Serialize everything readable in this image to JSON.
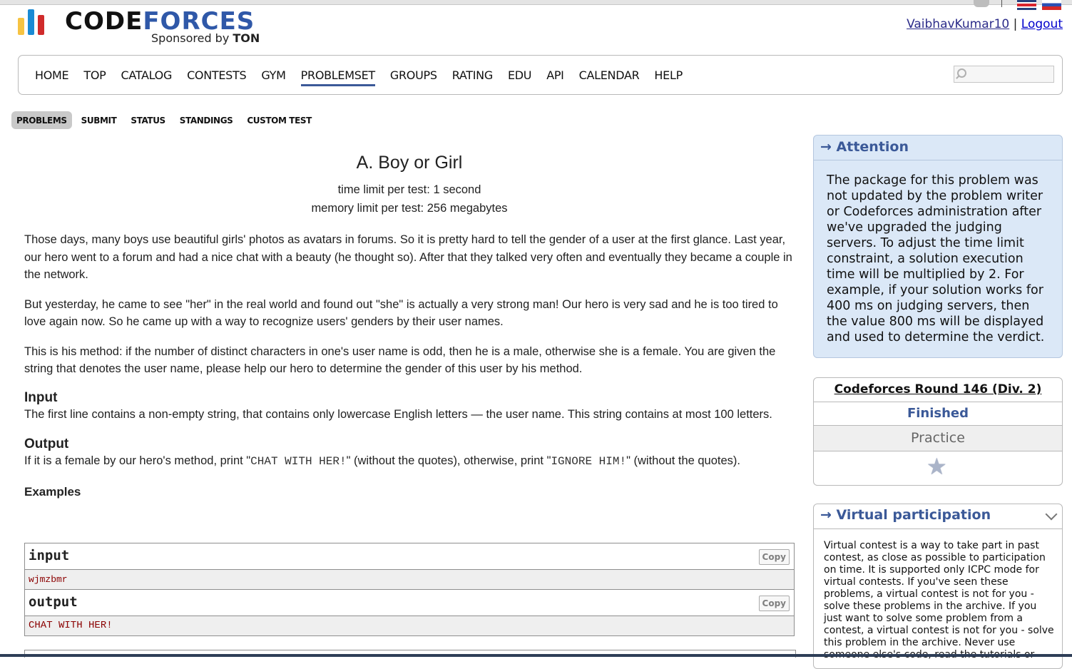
{
  "header": {
    "logo_word_1": "CODE",
    "logo_word_2": "FORCES",
    "sponsored_prefix": "Sponsored by ",
    "sponsor": "TON",
    "username": "VaibhavKumar10",
    "separator": "|",
    "logout": "Logout"
  },
  "menu": {
    "items": [
      "HOME",
      "TOP",
      "CATALOG",
      "CONTESTS",
      "GYM",
      "PROBLEMSET",
      "GROUPS",
      "RATING",
      "EDU",
      "API",
      "CALENDAR",
      "HELP"
    ],
    "active": "PROBLEMSET",
    "search_placeholder": ""
  },
  "submenu": {
    "items": [
      "PROBLEMS",
      "SUBMIT",
      "STATUS",
      "STANDINGS",
      "CUSTOM TEST"
    ],
    "active": "PROBLEMS"
  },
  "problem": {
    "title": "A. Boy or Girl",
    "time_limit": "time limit per test: 1 second",
    "memory_limit": "memory limit per test: 256 megabytes",
    "paragraphs": [
      "Those days, many boys use beautiful girls' photos as avatars in forums. So it is pretty hard to tell the gender of a user at the first glance. Last year, our hero went to a forum and had a nice chat with a beauty (he thought so). After that they talked very often and eventually they became a couple in the network.",
      "But yesterday, he came to see \"her\" in the real world and found out \"she\" is actually a very strong man! Our hero is very sad and he is too tired to love again now. So he came up with a way to recognize users' genders by their user names.",
      "This is his method: if the number of distinct characters in one's user name is odd, then he is a male, otherwise she is a female. You are given the string that denotes the user name, please help our hero to determine the gender of this user by his method."
    ],
    "input_title": "Input",
    "input_text": "The first line contains a non-empty string, that contains only lowercase English letters — the user name. This string contains at most 100 letters.",
    "output_title": "Output",
    "output_text_1": "If it is a female by our hero's method, print \"",
    "output_code_1": "CHAT WITH HER!",
    "output_text_2": "\" (without the quotes), otherwise, print \"",
    "output_code_2": "IGNORE HIM!",
    "output_text_3": "\" (without the quotes).",
    "examples_title": "Examples",
    "examples": [
      {
        "label": "input",
        "copy": "Copy",
        "value": "wjmzbmr"
      },
      {
        "label": "output",
        "copy": "Copy",
        "value": "CHAT WITH HER!"
      }
    ]
  },
  "sidebar": {
    "attention_title": "→ Attention",
    "attention_text": "The package for this problem was not updated by the problem writer or Codeforces administration after we've upgraded the judging servers. To adjust the time limit constraint, a solution execution time will be multiplied by 2. For example, if your solution works for 400 ms on judging servers, then the value 800 ms will be displayed and used to determine the verdict.",
    "round_name": "Codeforces Round 146 (Div. 2)",
    "round_status": "Finished",
    "round_practice": "Practice",
    "virtual_title": "→ Virtual participation",
    "virtual_text": "Virtual contest is a way to take part in past contest, as close as possible to participation on time. It is supported only ICPC mode for virtual contests. If you've seen these problems, a virtual contest is not for you - solve these problems in the archive. If you just want to solve some problem from a contest, a virtual contest is not for you - solve this problem in the archive. Never use someone else's code, read the tutorials or"
  },
  "colors": {
    "accent": "#3b5998",
    "attention_bg": "#dbe8f7",
    "example_value": "#8b0000"
  }
}
